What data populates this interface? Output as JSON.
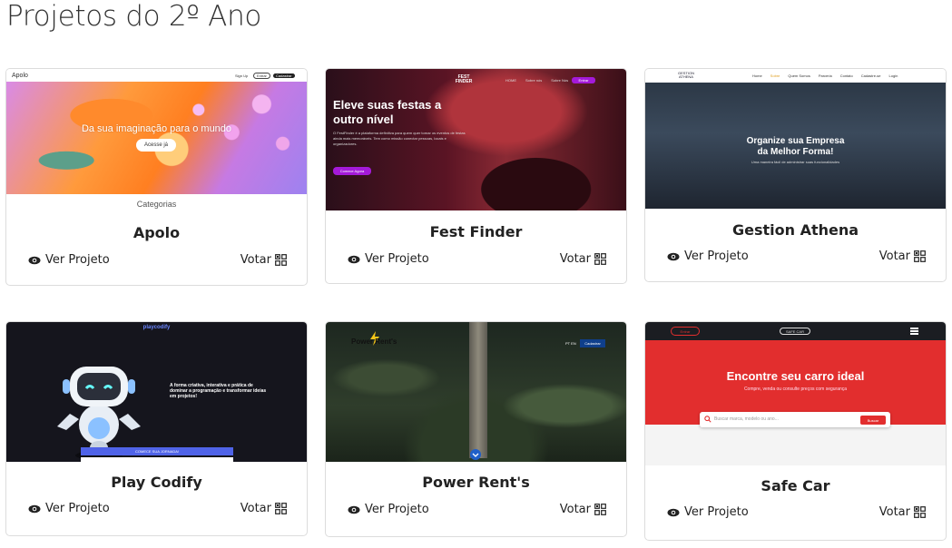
{
  "page": {
    "title": "Projetos do 2º Ano"
  },
  "actions": {
    "view_label": "Ver Projeto",
    "vote_label": "Votar"
  },
  "cards": [
    {
      "title": "Apolo",
      "thumb": {
        "nav_brand": "Apolo",
        "nav_links": [
          "Sign Up",
          "Entrar",
          "Cadastrar"
        ],
        "hero_text": "Da sua imaginação para o mundo",
        "hero_button": "Acesse já",
        "below": "Categorias"
      }
    },
    {
      "title": "Fest Finder",
      "thumb": {
        "logo": "FEST FINDER",
        "nav_links": [
          "HOME",
          "Sobre nós",
          "Sobre Nós",
          "Entrar"
        ],
        "hero_line1": "Eleve suas festas a",
        "hero_line2": "outro nível",
        "paragraph": "O FestFinder é a plataforma definitiva para quem quer tornar os eventos de festas ainda mais memoráveis. Tem como missão conectar pessoas, locais e organizadores.",
        "cta": "Comece Agora"
      }
    },
    {
      "title": "Gestion Athena",
      "thumb": {
        "logo": "GESTION ATHENA",
        "nav_links": [
          "Home",
          "Sobre",
          "Quem Somos",
          "Parceria",
          "Contato",
          "Cadastre-se",
          "Login"
        ],
        "hero_line1": "Organize sua Empresa",
        "hero_line2": "da Melhor Forma!",
        "sub": "Uma maneira fácil de administrar suas funcionalidades"
      }
    },
    {
      "title": "Play Codify",
      "thumb": {
        "brand": "playcodify",
        "text": "A forma criativa, interativa e prática de dominar a programação e transformar ideias em projetos!",
        "cta": "COMECE SUA JORNADA!"
      }
    },
    {
      "title": "Power Rent's",
      "thumb": {
        "logo": "Power Rent's",
        "lang": "PT EN",
        "button": "Cadastrar"
      }
    },
    {
      "title": "Safe Car",
      "thumb": {
        "login": "Entrar",
        "logo": "SAFE CAR",
        "hero_title": "Encontre seu carro ideal",
        "hero_sub": "Compre, venda ou consulte preços com segurança",
        "search_placeholder": "Buscar marca, modelo ou ano...",
        "search_button": "Buscar"
      }
    }
  ],
  "colors": {
    "apolo_btn": "#ffffff",
    "fest_cta": "#a41ad9",
    "codify_btn": "#4f63e8",
    "safecar_red": "#e22e2e",
    "powerrent_btn": "#0f3f8c"
  }
}
